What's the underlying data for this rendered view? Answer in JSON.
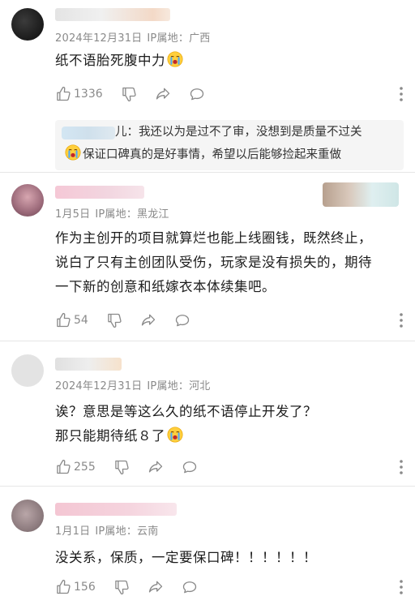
{
  "comments": [
    {
      "date": "2024年12月31日",
      "ip_label": "IP属地：",
      "ip_location": "广西",
      "text_line1": "纸不语胎死腹中力",
      "emoji": "crying-face",
      "like_count": "1336",
      "reply": {
        "name_suffix": "儿：",
        "line1": "我还以为是过不了审，没想到是质量不过关",
        "line2": "保证口碑真的是好事情，希望以后能够捡起来重做"
      }
    },
    {
      "date": "1月5日",
      "ip_label": "IP属地：",
      "ip_location": "黑龙江",
      "text_line1": "作为主创开的项目就算烂也能上线圈钱，既然终止，",
      "text_line2": "说白了只有主创团队受伤，玩家是没有损失的，期待",
      "text_line3": "一下新的创意和纸嫁衣本体续集吧。",
      "like_count": "54"
    },
    {
      "date": "2024年12月31日",
      "ip_label": "IP属地：",
      "ip_location": "河北",
      "text_line1": "诶？意思是等这么久的纸不语停止开发了？",
      "text_line2": "那只能期待纸８了",
      "emoji": "crying-face",
      "like_count": "255"
    },
    {
      "date": "1月1日",
      "ip_label": "IP属地：",
      "ip_location": "云南",
      "text_line1": "没关系，保质，一定要保口碑！！！！！！",
      "like_count": "156"
    }
  ],
  "colors": {
    "meta_gray": "#8a8a8a",
    "separator": "#e6e6e6",
    "reply_bg": "#f5f5f5"
  },
  "icons": [
    "thumbs-up-icon",
    "thumbs-down-icon",
    "share-icon",
    "comment-icon",
    "more-icon",
    "crying-face-emoji"
  ]
}
